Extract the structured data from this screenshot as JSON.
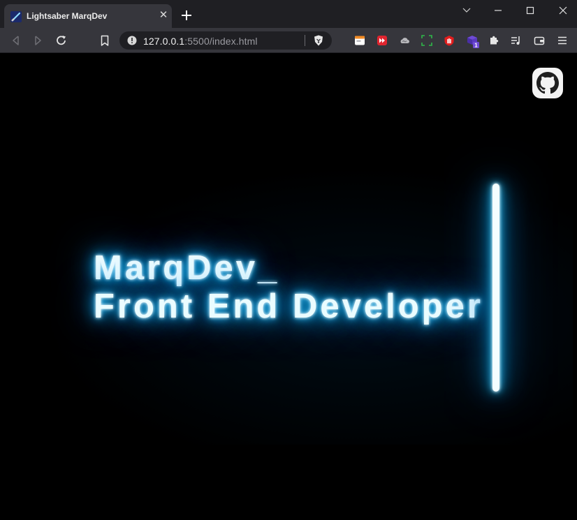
{
  "tab": {
    "title": "Lightsaber MarqDev",
    "close_glyph": "✕"
  },
  "window_controls": [
    "chevron-down",
    "minimize",
    "maximize",
    "close"
  ],
  "toolbar": {
    "url_host": "127.0.0.1",
    "url_rest": ":5500/index.html",
    "extensions": [
      "calendar-icon",
      "media-forward-icon",
      "cloud-icon",
      "screenshot-crop-icon",
      "hand-stop-icon",
      "cube-icon",
      "puzzle-icon",
      "playlist-icon",
      "wallet-icon",
      "menu-icon"
    ],
    "extension_badge": "1"
  },
  "page": {
    "headline_line1": "MarqDev_",
    "headline_line2": "Front End Developer",
    "github_icon": "github-icon"
  },
  "colors": {
    "glow": "#00b4ff",
    "tab_active": "#36363c",
    "tabstrip": "#1f1f23",
    "page_background": "#000000"
  }
}
